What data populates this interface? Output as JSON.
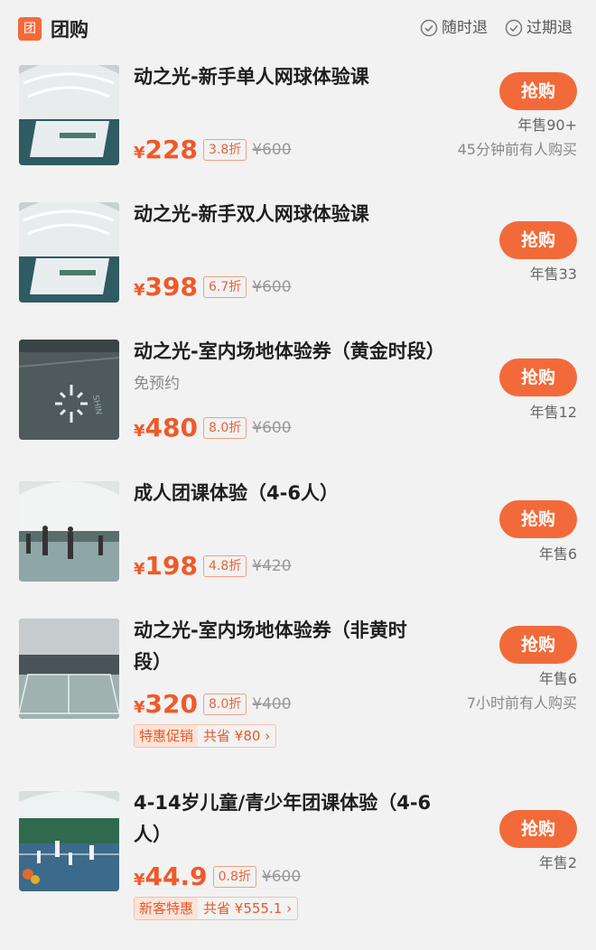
{
  "header": {
    "badge": "团",
    "title": "团购",
    "policy1": "随时退",
    "policy2": "过期退"
  },
  "buy_label": "抢购",
  "yen_symbol": "¥",
  "items": [
    {
      "title": "动之光-新手单人网球体验课",
      "price": "228",
      "discount": "3.8折",
      "orig": "¥600",
      "sold": "年售90+",
      "recent": "45分钟前有人购买"
    },
    {
      "title": "动之光-新手双人网球体验课",
      "price": "398",
      "discount": "6.7折",
      "orig": "¥600",
      "sold": "年售33"
    },
    {
      "title": "动之光-室内场地体验券（黄金时段）",
      "subtitle": "免预约",
      "price": "480",
      "discount": "8.0折",
      "orig": "¥600",
      "sold": "年售12"
    },
    {
      "title": "成人团课体验（4-6人）",
      "price": "198",
      "discount": "4.8折",
      "orig": "¥420",
      "sold": "年售6"
    },
    {
      "title_line1": "动之光-室内场地体验券（非黄时",
      "title_line2": "段）",
      "price": "320",
      "discount": "8.0折",
      "orig": "¥400",
      "sold": "年售6",
      "recent": "7小时前有人购买",
      "promo_tag": "特惠促销",
      "promo_save": "共省 ¥80"
    },
    {
      "title_line1": "4-14岁儿童/青少年团课体验（4-6",
      "title_line2": "人）",
      "price": "44.9",
      "discount": "0.8折",
      "orig": "¥600",
      "sold": "年售2",
      "promo_tag": "新客特惠",
      "promo_save": "共省 ¥555.1"
    }
  ],
  "colors": {
    "accent": "#f26a3a",
    "price": "#ee5a2a",
    "background": "#f2f2f2"
  }
}
